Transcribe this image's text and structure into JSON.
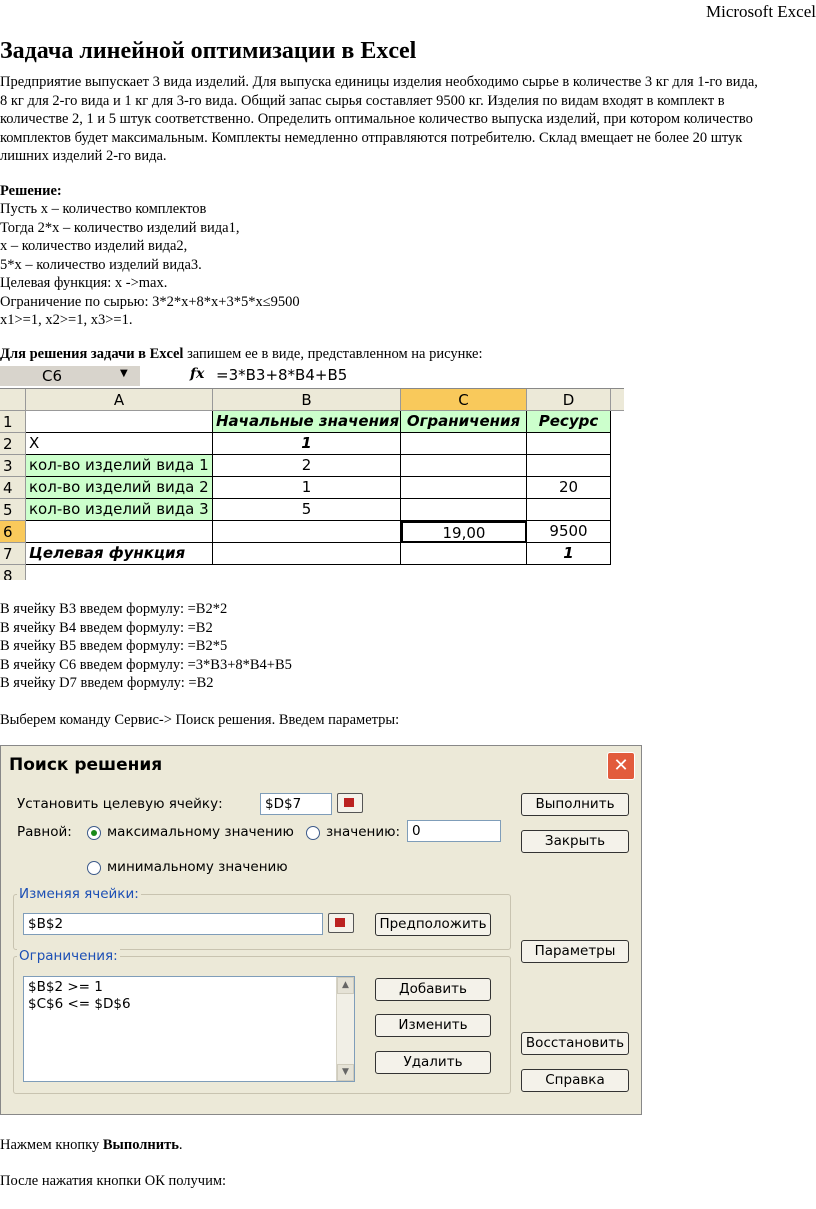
{
  "header": "Microsoft Excel",
  "title": "Задача линейной оптимизации в Excel",
  "intro_lines": [
    "Предприятие выпускает 3 вида изделий. Для выпуска единицы изделия необходимо сырье в количестве 3 кг для 1-го вида,",
    "8 кг для 2-го вида и 1 кг для 3-го вида. Общий запас сырья составляет 9500 кг. Изделия по видам входят в комплект в",
    "количестве 2, 1 и 5 штук соответственно. Определить оптимальное количество выпуска изделий, при котором количество",
    "комплектов будет максимальным. Комплекты немедленно отправляются потребителю. Склад вмещает не более 20 штук",
    "лишних изделий 2-го вида."
  ],
  "solution": {
    "heading": "Решение:",
    "lines": [
      "Пусть x – количество комплектов",
      "Тогда 2*x – количество изделий вида1,",
      "x – количество изделий вида2,",
      "5*x – количество изделий вида3.",
      "Целевая функция: x ->max.",
      "Ограничение по сырью: 3*2*x+8*x+3*5*x≤9500",
      "x1>=1, x2>=1, x3>=1."
    ],
    "excel_bold": "Для решения задачи в Excel",
    "excel_rest": " запишем ее в виде, представленном на рисунке:"
  },
  "sheet": {
    "name_box": "C6",
    "fx": "fx",
    "formula": "=3*B3+8*B4+B5",
    "columns": [
      "A",
      "B",
      "C",
      "D"
    ],
    "rows": [
      "1",
      "2",
      "3",
      "4",
      "5",
      "6",
      "7",
      "8"
    ],
    "headers": {
      "b": "Начальные значения",
      "c": "Ограничения",
      "d": "Ресурс"
    },
    "a2": "X",
    "b2": "1",
    "a3": "кол-во изделий вида 1",
    "b3": "2",
    "a4": "кол-во изделий вида 2",
    "b4": "1",
    "d4": "20",
    "a5": "кол-во изделий вида 3",
    "b5": "5",
    "c6": "19,00",
    "d6": "9500",
    "a7": "Целевая функция",
    "d7": "1"
  },
  "formulas": [
    "В ячейку B3 введем формулу: =B2*2",
    "В ячейку B4 введем формулу: =B2",
    "В ячейку B5 введем формулу: =B2*5",
    "В ячейку C6 введем формулу: =3*B3+8*B4+B5",
    "В ячейку D7 введем формулу: =B2"
  ],
  "service": "Выберем команду Сервис-> Поиск решения. Введем параметры:",
  "dialog": {
    "title": "Поиск решения",
    "target_label": "Установить целевую ячейку:",
    "target_value": "$D$7",
    "equal_label": "Равной:",
    "opt_max": "максимальному значению",
    "opt_value": "значению:",
    "value_field": "0",
    "opt_min": "минимальному значению",
    "change_group": "Изменяя ячейки:",
    "change_value": "$B$2",
    "guess_button": "Предположить",
    "constraints_group": "Ограничения:",
    "constraints": [
      "$B$2 >= 1",
      "$C$6 <= $D$6"
    ],
    "add_button": "Добавить",
    "change_button": "Изменить",
    "delete_button": "Удалить",
    "run_button": "Выполнить",
    "close_button": "Закрыть",
    "params_button": "Параметры",
    "restore_button": "Восстановить",
    "help_button": "Справка"
  },
  "press_pre": "Нажмем кнопку ",
  "press_bold": "Выполнить",
  "press_post": ".",
  "after": "После нажатия кнопки ОК получим:"
}
